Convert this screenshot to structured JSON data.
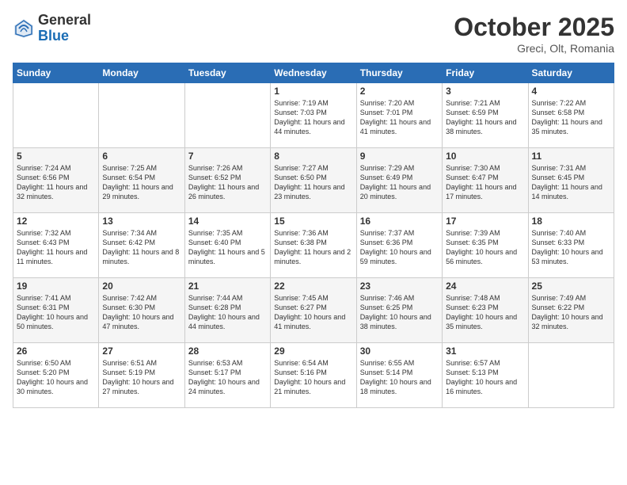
{
  "header": {
    "logo_general": "General",
    "logo_blue": "Blue",
    "month_title": "October 2025",
    "location": "Greci, Olt, Romania"
  },
  "days_of_week": [
    "Sunday",
    "Monday",
    "Tuesday",
    "Wednesday",
    "Thursday",
    "Friday",
    "Saturday"
  ],
  "weeks": [
    [
      {
        "day": "",
        "info": ""
      },
      {
        "day": "",
        "info": ""
      },
      {
        "day": "",
        "info": ""
      },
      {
        "day": "1",
        "info": "Sunrise: 7:19 AM\nSunset: 7:03 PM\nDaylight: 11 hours and 44 minutes."
      },
      {
        "day": "2",
        "info": "Sunrise: 7:20 AM\nSunset: 7:01 PM\nDaylight: 11 hours and 41 minutes."
      },
      {
        "day": "3",
        "info": "Sunrise: 7:21 AM\nSunset: 6:59 PM\nDaylight: 11 hours and 38 minutes."
      },
      {
        "day": "4",
        "info": "Sunrise: 7:22 AM\nSunset: 6:58 PM\nDaylight: 11 hours and 35 minutes."
      }
    ],
    [
      {
        "day": "5",
        "info": "Sunrise: 7:24 AM\nSunset: 6:56 PM\nDaylight: 11 hours and 32 minutes."
      },
      {
        "day": "6",
        "info": "Sunrise: 7:25 AM\nSunset: 6:54 PM\nDaylight: 11 hours and 29 minutes."
      },
      {
        "day": "7",
        "info": "Sunrise: 7:26 AM\nSunset: 6:52 PM\nDaylight: 11 hours and 26 minutes."
      },
      {
        "day": "8",
        "info": "Sunrise: 7:27 AM\nSunset: 6:50 PM\nDaylight: 11 hours and 23 minutes."
      },
      {
        "day": "9",
        "info": "Sunrise: 7:29 AM\nSunset: 6:49 PM\nDaylight: 11 hours and 20 minutes."
      },
      {
        "day": "10",
        "info": "Sunrise: 7:30 AM\nSunset: 6:47 PM\nDaylight: 11 hours and 17 minutes."
      },
      {
        "day": "11",
        "info": "Sunrise: 7:31 AM\nSunset: 6:45 PM\nDaylight: 11 hours and 14 minutes."
      }
    ],
    [
      {
        "day": "12",
        "info": "Sunrise: 7:32 AM\nSunset: 6:43 PM\nDaylight: 11 hours and 11 minutes."
      },
      {
        "day": "13",
        "info": "Sunrise: 7:34 AM\nSunset: 6:42 PM\nDaylight: 11 hours and 8 minutes."
      },
      {
        "day": "14",
        "info": "Sunrise: 7:35 AM\nSunset: 6:40 PM\nDaylight: 11 hours and 5 minutes."
      },
      {
        "day": "15",
        "info": "Sunrise: 7:36 AM\nSunset: 6:38 PM\nDaylight: 11 hours and 2 minutes."
      },
      {
        "day": "16",
        "info": "Sunrise: 7:37 AM\nSunset: 6:36 PM\nDaylight: 10 hours and 59 minutes."
      },
      {
        "day": "17",
        "info": "Sunrise: 7:39 AM\nSunset: 6:35 PM\nDaylight: 10 hours and 56 minutes."
      },
      {
        "day": "18",
        "info": "Sunrise: 7:40 AM\nSunset: 6:33 PM\nDaylight: 10 hours and 53 minutes."
      }
    ],
    [
      {
        "day": "19",
        "info": "Sunrise: 7:41 AM\nSunset: 6:31 PM\nDaylight: 10 hours and 50 minutes."
      },
      {
        "day": "20",
        "info": "Sunrise: 7:42 AM\nSunset: 6:30 PM\nDaylight: 10 hours and 47 minutes."
      },
      {
        "day": "21",
        "info": "Sunrise: 7:44 AM\nSunset: 6:28 PM\nDaylight: 10 hours and 44 minutes."
      },
      {
        "day": "22",
        "info": "Sunrise: 7:45 AM\nSunset: 6:27 PM\nDaylight: 10 hours and 41 minutes."
      },
      {
        "day": "23",
        "info": "Sunrise: 7:46 AM\nSunset: 6:25 PM\nDaylight: 10 hours and 38 minutes."
      },
      {
        "day": "24",
        "info": "Sunrise: 7:48 AM\nSunset: 6:23 PM\nDaylight: 10 hours and 35 minutes."
      },
      {
        "day": "25",
        "info": "Sunrise: 7:49 AM\nSunset: 6:22 PM\nDaylight: 10 hours and 32 minutes."
      }
    ],
    [
      {
        "day": "26",
        "info": "Sunrise: 6:50 AM\nSunset: 5:20 PM\nDaylight: 10 hours and 30 minutes."
      },
      {
        "day": "27",
        "info": "Sunrise: 6:51 AM\nSunset: 5:19 PM\nDaylight: 10 hours and 27 minutes."
      },
      {
        "day": "28",
        "info": "Sunrise: 6:53 AM\nSunset: 5:17 PM\nDaylight: 10 hours and 24 minutes."
      },
      {
        "day": "29",
        "info": "Sunrise: 6:54 AM\nSunset: 5:16 PM\nDaylight: 10 hours and 21 minutes."
      },
      {
        "day": "30",
        "info": "Sunrise: 6:55 AM\nSunset: 5:14 PM\nDaylight: 10 hours and 18 minutes."
      },
      {
        "day": "31",
        "info": "Sunrise: 6:57 AM\nSunset: 5:13 PM\nDaylight: 10 hours and 16 minutes."
      },
      {
        "day": "",
        "info": ""
      }
    ]
  ]
}
